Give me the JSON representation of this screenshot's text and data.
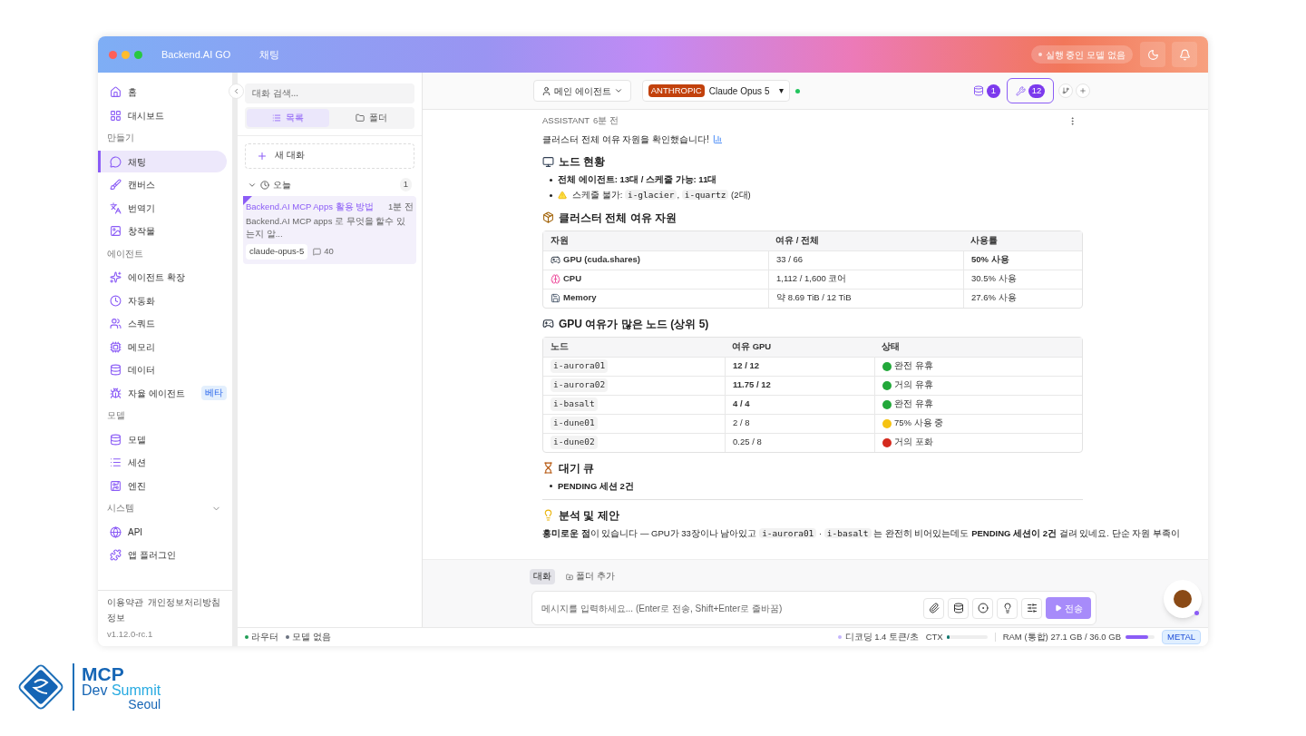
{
  "window": {
    "app_name": "Backend.AI GO",
    "page_title": "채팅",
    "model_status": "실행 중인 모델 없음"
  },
  "sidebar": {
    "sections": [
      {
        "items": [
          {
            "label": "홈",
            "selected": false
          },
          {
            "label": "대시보드",
            "selected": false
          }
        ]
      },
      {
        "label": "만들기",
        "items": [
          {
            "label": "채팅",
            "selected": true
          },
          {
            "label": "캔버스",
            "selected": false
          },
          {
            "label": "번역기",
            "selected": false
          },
          {
            "label": "창작물",
            "selected": false
          }
        ]
      },
      {
        "label": "에이전트",
        "items": [
          {
            "label": "에이전트 확장",
            "selected": false
          },
          {
            "label": "자동화",
            "selected": false
          },
          {
            "label": "스쿼드",
            "selected": false
          },
          {
            "label": "메모리",
            "selected": false
          },
          {
            "label": "데이터",
            "selected": false
          },
          {
            "label": "자율 에이전트",
            "selected": false,
            "badge": "베타"
          }
        ]
      },
      {
        "label": "모델",
        "items": [
          {
            "label": "모델",
            "selected": false
          },
          {
            "label": "세션",
            "selected": false
          },
          {
            "label": "엔진",
            "selected": false
          }
        ]
      },
      {
        "label": "시스템",
        "expanded": true,
        "items": [
          {
            "label": "API",
            "selected": false
          },
          {
            "label": "앱 플러그인",
            "selected": false
          }
        ]
      }
    ],
    "footer_links": [
      "이용약관",
      "개인정보처리방침",
      "정보"
    ],
    "version": "v1.12.0-rc.1"
  },
  "conversations": {
    "search": {
      "placeholder": "대화 검색..."
    },
    "view_tabs": [
      {
        "label": "목록",
        "selected": true
      },
      {
        "label": "폴더",
        "selected": false
      }
    ],
    "new_button": "새 대화",
    "groups": [
      {
        "label": "오늘",
        "count": "1",
        "expanded": true,
        "items": [
          {
            "title": "Backend.AI MCP Apps 활용 방법",
            "time": "1분 전",
            "preview": "Backend.AI MCP apps 로 무엇을 할수 있는지 알...",
            "tag": "claude-opus-5",
            "messages": "40",
            "selected": true
          }
        ]
      }
    ]
  },
  "toolbar": {
    "agent": "메인 에이전트",
    "provider": "ANTHROPIC",
    "model": "Claude Opus 5",
    "model_caret": "▾",
    "connected": true,
    "data_count": "1",
    "tools_count": "12",
    "tools_active": true
  },
  "message": {
    "role": "ASSISTANT",
    "time": "6분 전",
    "blocks": [
      {
        "kind": "text",
        "text": "클러스터 전체 여유 자원을 확인했습니다!"
      },
      {
        "kind": "heading",
        "text": "노드 현황"
      },
      {
        "kind": "bullets",
        "items": [
          [
            {
              "kind": "bold",
              "text": "전체 에이전트: 13대 / 스케줄 가능: 11대"
            }
          ],
          [
            {
              "kind": "warning"
            },
            {
              "kind": "text",
              "text": " 스케줄 불가: "
            },
            {
              "kind": "code",
              "text": "i-glacier"
            },
            {
              "kind": "text",
              "text": ", "
            },
            {
              "kind": "code",
              "text": "i-quartz"
            },
            {
              "kind": "text",
              "text": " (2대)"
            }
          ]
        ]
      },
      {
        "kind": "heading",
        "text": "클러스터 전체 여유 자원"
      },
      {
        "kind": "table",
        "columns": [
          "자원",
          "여유 / 전체",
          "사용률"
        ],
        "rows": [
          {
            "cells": [
              "GPU (cuda.shares)",
              "33 / 66",
              "50% 사용"
            ],
            "strong": [
              true,
              false,
              true
            ]
          },
          {
            "cells": [
              "CPU",
              "1,112 / 1,600 코어",
              "30.5% 사용"
            ],
            "strong": [
              true,
              false,
              false
            ]
          },
          {
            "cells": [
              "Memory",
              "약 8.69 TiB / 12 TiB",
              "27.6% 사용"
            ],
            "strong": [
              true,
              false,
              false
            ]
          }
        ]
      },
      {
        "kind": "heading",
        "text": "GPU 여유가 많은 노드 (상위 5)"
      },
      {
        "kind": "table",
        "columns": [
          "노드",
          "여유 GPU",
          "상태"
        ],
        "rows": [
          {
            "cells": [
              "i-aurora01",
              "12 / 12",
              "완전 유휴"
            ],
            "strong": [
              false,
              true,
              false
            ],
            "color": "#22a83a"
          },
          {
            "cells": [
              "i-aurora02",
              "11.75 / 12",
              "거의 유휴"
            ],
            "strong": [
              false,
              true,
              false
            ],
            "color": "#22a83a"
          },
          {
            "cells": [
              "i-basalt",
              "4 / 4",
              "완전 유휴"
            ],
            "strong": [
              false,
              true,
              false
            ],
            "color": "#22a83a"
          },
          {
            "cells": [
              "i-dune01",
              "2 / 8",
              "75% 사용 중"
            ],
            "strong": [
              false,
              false,
              false
            ],
            "color": "#f5c211"
          },
          {
            "cells": [
              "i-dune02",
              "0.25 / 8",
              "거의 포화"
            ],
            "strong": [
              false,
              false,
              false
            ],
            "color": "#d42a1e"
          }
        ]
      },
      {
        "kind": "heading",
        "text": "대기 큐"
      },
      {
        "kind": "bullets",
        "items": [
          [
            {
              "kind": "bold",
              "text": "PENDING 세션 2건"
            }
          ]
        ]
      },
      {
        "kind": "rule"
      },
      {
        "kind": "heading",
        "text": "분석 및 제안"
      },
      {
        "kind": "paragraph",
        "parts": [
          {
            "kind": "bold",
            "text": "흥미로운 점"
          },
          {
            "kind": "text",
            "text": "이 있습니다 — GPU가 33장이나 남아있고 "
          },
          {
            "kind": "code",
            "text": "i-aurora01"
          },
          {
            "kind": "text",
            "text": " · "
          },
          {
            "kind": "code",
            "text": "i-basalt"
          },
          {
            "kind": "text",
            "text": " 는 완전히 비어있는데도 "
          },
          {
            "kind": "bold",
            "text": "PENDING 세션이 2건"
          },
          {
            "kind": "text",
            "text": " 걸려 있네요. 단순 자원 부족이"
          }
        ]
      }
    ]
  },
  "composer": {
    "tabs": [
      {
        "label": "대화",
        "selected": true
      },
      {
        "label": "폴더 추가",
        "selected": false
      }
    ],
    "placeholder": "메시지를 입력하세요... (Enter로 전송, Shift+Enter로 줄바꿈)",
    "send": "전송",
    "send_disabled": true
  },
  "status_bar": {
    "left": [
      {
        "label": "라우터",
        "color": "#1f9d55"
      },
      {
        "label": "모델 없음",
        "color": "#6b7280"
      }
    ],
    "decoding": "디코딩 1.4 토큰/초",
    "ctx_label": "CTX",
    "ctx": {
      "level": 0.08
    },
    "ram_label": "RAM (통합) 27.1 GB / 36.0 GB",
    "ram": {
      "level": 0.78
    },
    "backend": "METAL"
  },
  "logo": {
    "line1": "MCP",
    "line2a": "Dev",
    "line2b": "Summit",
    "line3": "Seoul"
  }
}
